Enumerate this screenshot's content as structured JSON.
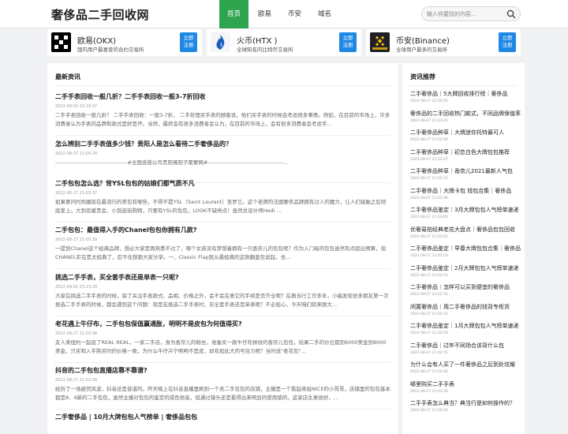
{
  "header": {
    "logo": "奢侈品二手回收网",
    "nav": [
      "首页",
      "欧易",
      "币安",
      "域名"
    ],
    "search_placeholder": "输入你要找的内容..."
  },
  "exchanges": [
    {
      "name": "欧易(OKX)",
      "desc": "国内用户最喜爱的合约交易所",
      "button": "立即\n注册",
      "logo_color": "#000000"
    },
    {
      "name": "火币(HTX )",
      "desc": "全球知名的比特币交易所",
      "button": "立即\n注册",
      "logo_color": "#1e5bb8"
    },
    {
      "name": "币安(Binance)",
      "desc": "全球用户最多的交易所",
      "button": "立即\n注册",
      "logo_color": "#1e2026"
    }
  ],
  "main": {
    "title": "最新资讯",
    "articles": [
      {
        "title": "二手手表回收一般几折？二手手表回收一般3-7折回收",
        "date": "2022-09-02 23:23:47",
        "summary": "二手手表回收一般几折？ 二手手表回收：一般3-7折， 二手处理买手表的顾客说，他们买手表的时候会考虑很多事情。例如，在目前的市场上，许多消费者认为手表的品牌和款式是好是坏。当然，最终会有很多消费者会认为，在目前的市场上，会有很多消费者会考虑手..."
      },
      {
        "title": "怎么辨别二手手表值多少钱？贵阳人是怎么看待二手奢侈品的？",
        "date": "2022-08-27 21:04:24",
        "summary": "---------------------------------------#全国连锁公司贵阳佛阳子聚奢网#-----------------------------------------..."
      },
      {
        "title": "二手包包怎么选？背YSL包包的姑娘们都气质不凡",
        "date": "2022-08-27 21:03:37",
        "summary": "如果要问时尚圈现在最流行的美包有哪些，不得不提YSL（Saint Laurent）圣罗兰。这个老牌的法国奢侈品牌拥有过人的魔力，让人们接触之后彻底爱上。大到名媛贵会，小到逛街购物，只要有YSL的包包，LOOK不缺亮点！虽然总设计师Hedi ..."
      },
      {
        "title": "二手包包：最值得入手的Chanel包包你拥有几款?",
        "date": "2022-08-27 21:03:30",
        "summary": "一提到Chanel这个经典品牌，想必大家是再熟悉不过了，哪个女孩没有梦想着拥有一只香奈儿的包包呢？作为入门级的包包虽然有点超出预算，但CHANEL实在是太经典了，忍不住想跟大家分享。一、Classic Flap就从最经典的这款翻盖包说起，也..."
      },
      {
        "title": "挑选二手手表，买全套手表还是单表一只呢?",
        "date": "2022-09-02 23:23:29",
        "summary": "大家在挑选二手手表的时候，除了关注手表款式、品相、价格之外，会不会在意它的手续是否齐全呢？在典当行工作多年，小编发现很多朋友第一次挑选二手手表的时候，都会遇到这个问题：就是在挑选二手手表时，买全套手表还是单表呢？不必担心，今天咱们就来跟大..."
      },
      {
        "title": "老花遇上牛仔布，二手包包保值赢通胀，明明不是皮包为何值得买?",
        "date": "2022-08-27 21:03:38",
        "summary": "友人来纽约一起逛了REAL REAL，一家二手店，身为香奈儿的粉丝，准备买一款牛仔布拼纹的香奈儿包包，结果二手的价位都到6000美金到8000美金，只买和入手购买时的价格一致，为什么牛仔卉宁明明不是皮，却有如此大的号召力呢？当时说\"老花包\"..."
      },
      {
        "title": "抖音的二手包包直播店靠不靠谱?",
        "date": "2022-08-27 21:02:39",
        "summary": "经历了一场避贸风波，抖音还是昔道的。昨天晚上在抖音直播里刷到一个卖二手包包的店铺，主播是一个看起来挺NICE的小哥哥，店铺里的包包基本都是8、9新的二手包包，虽然主播对包包的鉴定的成色很高，但通过镜头还是看得出来明显的使用感的，这家店生意很好，..."
      },
      {
        "title": "二手奢侈品 | 10月大牌包包人气榜单 | 奢侈品包包",
        "date": "",
        "summary": ""
      }
    ]
  },
  "side": {
    "title": "资讯推荐",
    "items": [
      {
        "title": "二手奢侈品｜5大牌回收排行榜｜奢侈品",
        "date": "2022-08-27 21:02:05"
      },
      {
        "title": "奢侈品的二手回收热门款式，不同品牌保值率",
        "date": "2022-08-27 21:03:20"
      },
      {
        "title": "二手奢侈品种草｜大牌迷你托特最可人",
        "date": "2022-08-27 21:02:06"
      },
      {
        "title": "二手奢侈品种草｜初恋白色大牌包包推荐",
        "date": "2022-08-27 21:02:07"
      },
      {
        "title": "二手奢侈品种草｜香奈儿2021最新人气包",
        "date": "2022-08-27 21:02:21"
      },
      {
        "title": "二手奢侈品｜大牌卡包 钱包合集｜奢侈品",
        "date": "2022-08-27 21:02:48"
      },
      {
        "title": "二手奢侈品鉴定｜3月大牌包包人气榜单速递",
        "date": "2022-08-27 21:03:00"
      },
      {
        "title": "优奢易拍经典老花大盘点｜奢侈品包包回收",
        "date": "2022-08-27 21:03:01"
      },
      {
        "title": "二手奢侈品鉴定｜早春大牌包包合集｜奢侈品",
        "date": "2022-08-27 21:02:50"
      },
      {
        "title": "二手奢侈品鉴定｜2月大牌包包人气榜单速递",
        "date": "2022-08-27 21:02:51"
      },
      {
        "title": "二手奢侈品｜怎样可以买到便宜的奢侈品",
        "date": "2022-08-27 21:02:52"
      },
      {
        "title": "闲置奢侈品｜用二手奢侈品的钱背专柜货",
        "date": "2022-08-27 21:02:53"
      },
      {
        "title": "二手奢侈品鉴定｜1月大牌包包人气榜单速递",
        "date": "2022-08-27 21:02:54"
      },
      {
        "title": "二手奢侈品｜过年不同场合该背什么包",
        "date": "2022-08-27 21:02:55"
      },
      {
        "title": "为什么会有人买了一件奢侈品之后到处炫耀",
        "date": "2022-08-27 21:02:40"
      },
      {
        "title": "哪里购买二手手表",
        "date": "2022-08-27 21:03:34"
      },
      {
        "title": "二手手表怎么典当？典当行是如何操作的？",
        "date": "2022-08-27 21:04:56"
      }
    ]
  },
  "colors": {
    "accent": "#2ea44f",
    "button": "#1e88e5"
  }
}
